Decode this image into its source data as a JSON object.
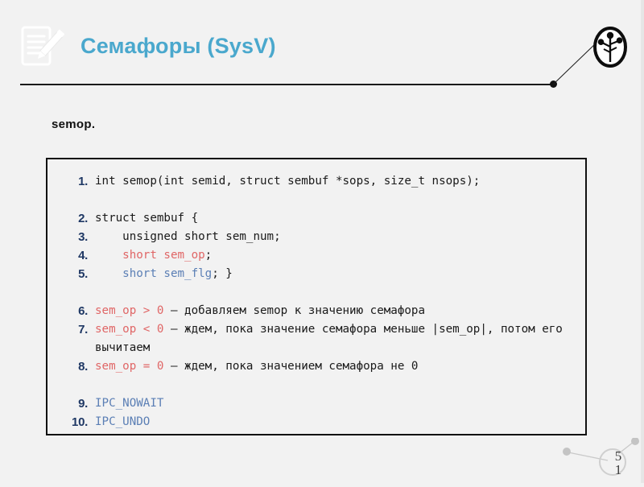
{
  "slide": {
    "background_color": "#f2f2f2",
    "title": "Семафоры (SysV)",
    "title_color": "#4aa8cd",
    "header_icon": "notepad-pencil-icon",
    "brand_logo": "plant-in-circle-logo",
    "section_label": "semop."
  },
  "code_block": {
    "border_color": "#111111",
    "line_number_color": "#1f3864",
    "keyword_red": "#e06666",
    "keyword_blue": "#5b7fb5",
    "lines": [
      {
        "number": "1.",
        "parts": [
          {
            "text": "int semop(int semid, struct sembuf *sops, size_t nsops);",
            "color": "plain"
          }
        ]
      },
      {
        "number": "",
        "parts": [],
        "spacer": true
      },
      {
        "number": "2.",
        "parts": [
          {
            "text": "struct sembuf {",
            "color": "plain"
          }
        ]
      },
      {
        "number": "3.",
        "parts": [
          {
            "text": "    unsigned short sem_num;",
            "color": "plain"
          }
        ]
      },
      {
        "number": "4.",
        "parts": [
          {
            "text": "    ",
            "color": "plain"
          },
          {
            "text": "short sem_op",
            "color": "red"
          },
          {
            "text": ";",
            "color": "plain"
          }
        ]
      },
      {
        "number": "5.",
        "parts": [
          {
            "text": "    ",
            "color": "plain"
          },
          {
            "text": "short sem_flg",
            "color": "blue"
          },
          {
            "text": "; }",
            "color": "plain"
          }
        ]
      },
      {
        "number": "",
        "parts": [],
        "spacer": true
      },
      {
        "number": "6.",
        "parts": [
          {
            "text": "sem_op > 0",
            "color": "red"
          },
          {
            "text": " — добавляем semop к значению семафора",
            "color": "plain"
          }
        ]
      },
      {
        "number": "7.",
        "parts": [
          {
            "text": "sem_op < 0",
            "color": "red"
          },
          {
            "text": " — ждем, пока значение семафора меньше |sem_op|, потом его вычитаем",
            "color": "plain"
          }
        ]
      },
      {
        "number": "8.",
        "parts": [
          {
            "text": "sem_op = 0",
            "color": "red"
          },
          {
            "text": " — ждем, пока значением семафора не 0",
            "color": "plain"
          }
        ]
      },
      {
        "number": "",
        "parts": [],
        "spacer": true
      },
      {
        "number": "9.",
        "parts": [
          {
            "text": "IPC_NOWAIT",
            "color": "blue"
          }
        ]
      },
      {
        "number": "10.",
        "parts": [
          {
            "text": "IPC_UNDO",
            "color": "blue"
          }
        ]
      }
    ]
  },
  "footer": {
    "page_number_digits": [
      "5",
      "1"
    ]
  }
}
